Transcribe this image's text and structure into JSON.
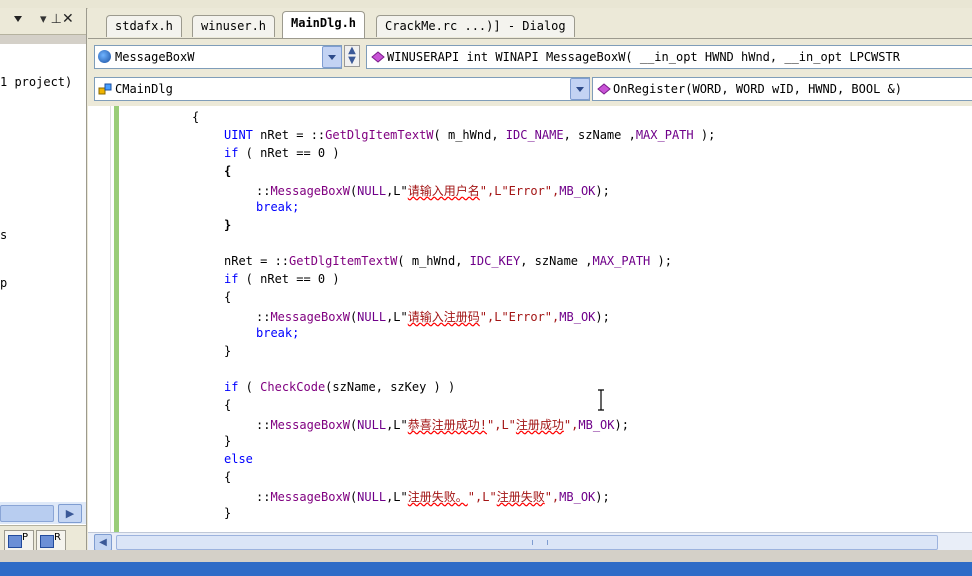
{
  "left_pane": {
    "project_text": "1 project)",
    "tree_s": "s",
    "tree_p": "p",
    "tab1_letter": "P",
    "tab2_letter": "R"
  },
  "tabs": [
    {
      "label": "stdafx.h"
    },
    {
      "label": "winuser.h"
    },
    {
      "label": "MainDlg.h"
    },
    {
      "label": "CrackMe.rc ...)] - Dialog"
    }
  ],
  "combos": {
    "scope": "MessageBoxW",
    "signature": "WINUSERAPI int WINAPI MessageBoxW( __in_opt HWND hWnd, __in_opt LPCWSTR",
    "class": "CMainDlg",
    "member": "OnRegister(WORD, WORD wID, HWND, BOOL &)"
  },
  "code": {
    "l1": "{",
    "l2a": "UINT",
    "l2b": " nRet = ::",
    "l2c": "GetDlgItemTextW",
    "l2d": "( m_hWnd, ",
    "l2e": "IDC_NAME",
    "l2f": ", szName ,",
    "l2g": "MAX_PATH",
    "l2h": " );",
    "l3a": "if",
    "l3b": " ( nRet == 0 )",
    "l4": "{",
    "l5a": "::",
    "l5b": "MessageBoxW",
    "l5c": "(",
    "l5d": "NULL",
    "l5e": ",L\"",
    "l5f": "请输入用户名",
    "l5g": "\",L\"Error\",",
    "l5h": "MB_OK",
    "l5i": ");",
    "l6": "break;",
    "l7": "}",
    "l8a": "nRet = ::",
    "l8b": "GetDlgItemTextW",
    "l8c": "( m_hWnd, ",
    "l8d": "IDC_KEY",
    "l8e": ", szName ,",
    "l8f": "MAX_PATH",
    "l8g": " );",
    "l9a": "if",
    "l9b": " ( nRet == 0 )",
    "l10": "{",
    "l11a": "::",
    "l11b": "MessageBoxW",
    "l11c": "(",
    "l11d": "NULL",
    "l11e": ",L\"",
    "l11f": "请输入注册码",
    "l11g": "\",L\"Error\",",
    "l11h": "MB_OK",
    "l11i": ");",
    "l12": "break;",
    "l13": "}",
    "l14a": "if",
    "l14b": " ( ",
    "l14c": "CheckCode",
    "l14d": "(szName, szKey ) )",
    "l15": "{",
    "l16a": "::",
    "l16b": "MessageBoxW",
    "l16c": "(",
    "l16d": "NULL",
    "l16e": ",L\"",
    "l16f": "恭喜注册成功!",
    "l16g": "\",L\"",
    "l16h": "注册成功",
    "l16i": "\",",
    "l16j": "MB_OK",
    "l16k": ");",
    "l17": "}",
    "l18": "else",
    "l19": "{",
    "l20a": "::",
    "l20b": "MessageBoxW",
    "l20c": "(",
    "l20d": "NULL",
    "l20e": ",L\"",
    "l20f": "注册失败。",
    "l20g": "\",L\"",
    "l20h": "注册失败",
    "l20i": "\",",
    "l20j": "MB_OK",
    "l20k": ");",
    "l21": "}"
  },
  "colors": {
    "keyword": "#0000ff",
    "function": "#800080",
    "string": "#a31515",
    "taskbar": "#2e6bc7"
  },
  "icons": [
    "pin-icon",
    "close-icon",
    "globe-icon",
    "class-icon",
    "method-icon"
  ]
}
